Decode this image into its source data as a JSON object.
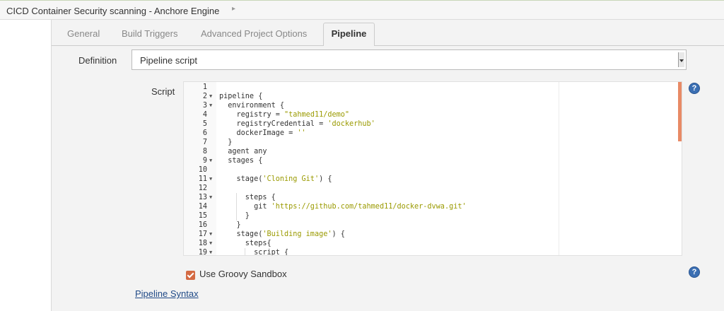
{
  "breadcrumb": {
    "title": "CICD Container Security scanning - Anchore Engine",
    "arrow": "▸"
  },
  "tabs": [
    {
      "label": "General"
    },
    {
      "label": "Build Triggers"
    },
    {
      "label": "Advanced Project Options"
    },
    {
      "label": "Pipeline",
      "active": true
    }
  ],
  "form": {
    "definition_label": "Definition",
    "definition_value": "Pipeline script",
    "script_label": "Script",
    "sandbox_label": "Use Groovy Sandbox",
    "sandbox_checked": true,
    "syntax_link": "Pipeline Syntax",
    "help_icon": "?"
  },
  "colors": {
    "accent": "#d46a43",
    "link": "#204a87",
    "string": "#9a9a00",
    "help": "#3b6fb3"
  },
  "editor": {
    "lines": [
      {
        "n": "1",
        "fold": false,
        "code": ""
      },
      {
        "n": "2",
        "fold": true,
        "code": "pipeline {"
      },
      {
        "n": "3",
        "fold": true,
        "code": "  environment {"
      },
      {
        "n": "4",
        "fold": false,
        "code": "    registry = \"tahmed11/demo\""
      },
      {
        "n": "5",
        "fold": false,
        "code": "    registryCredential = 'dockerhub'"
      },
      {
        "n": "6",
        "fold": false,
        "code": "    dockerImage = ''"
      },
      {
        "n": "7",
        "fold": false,
        "code": "  }"
      },
      {
        "n": "8",
        "fold": false,
        "code": "  agent any"
      },
      {
        "n": "9",
        "fold": true,
        "code": "  stages {"
      },
      {
        "n": "10",
        "fold": false,
        "code": ""
      },
      {
        "n": "11",
        "fold": true,
        "code": "    stage('Cloning Git') {"
      },
      {
        "n": "12",
        "fold": false,
        "code": ""
      },
      {
        "n": "13",
        "fold": true,
        "code": "      steps {"
      },
      {
        "n": "14",
        "fold": false,
        "code": "        git 'https://github.com/tahmed11/docker-dvwa.git'"
      },
      {
        "n": "15",
        "fold": false,
        "code": "      }"
      },
      {
        "n": "16",
        "fold": false,
        "code": "    }"
      },
      {
        "n": "17",
        "fold": true,
        "code": "    stage('Building image') {"
      },
      {
        "n": "18",
        "fold": true,
        "code": "      steps{"
      },
      {
        "n": "19",
        "fold": true,
        "code": "        script {"
      }
    ]
  }
}
